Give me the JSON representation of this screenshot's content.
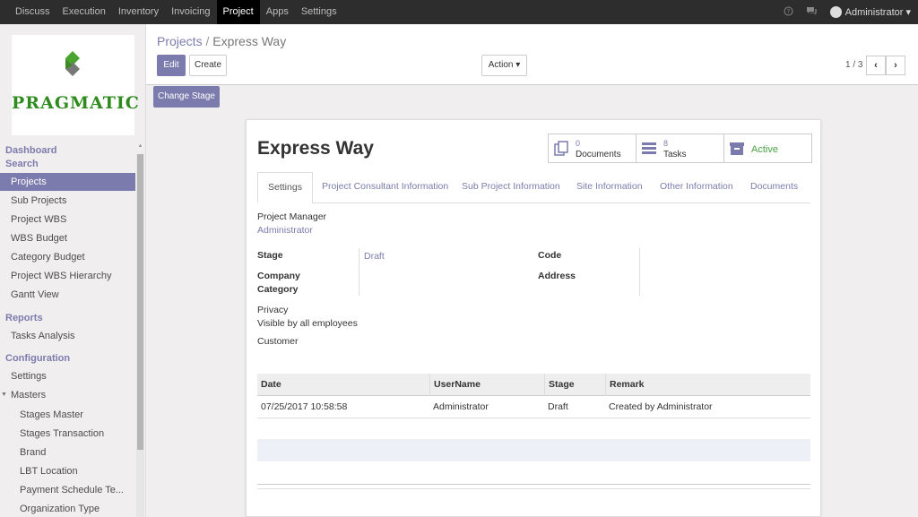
{
  "navbar": {
    "menu": [
      {
        "label": "Discuss",
        "active": false
      },
      {
        "label": "Execution",
        "active": false
      },
      {
        "label": "Inventory",
        "active": false
      },
      {
        "label": "Invoicing",
        "active": false
      },
      {
        "label": "Project",
        "active": true
      },
      {
        "label": "Apps",
        "active": false
      },
      {
        "label": "Settings",
        "active": false
      }
    ],
    "user": "Administrator ▾",
    "icons": [
      "help-icon",
      "chat-icon"
    ]
  },
  "logo": {
    "text": "PRAGMATIC"
  },
  "sidebar": {
    "dashboard": "Dashboard",
    "search": "Search",
    "search_items": [
      "Projects",
      "Sub Projects",
      "Project WBS",
      "WBS Budget",
      "Category Budget",
      "Project WBS Hierarchy",
      "Gantt View"
    ],
    "reports": "Reports",
    "reports_items": [
      "Tasks Analysis"
    ],
    "configuration": "Configuration",
    "config_items": [
      "Settings"
    ],
    "masters": "Masters",
    "masters_items": [
      "Stages Master",
      "Stages Transaction",
      "Brand",
      "LBT Location",
      "Payment Schedule Te...",
      "Organization Type"
    ]
  },
  "control": {
    "breadcrumb_root": "Projects",
    "breadcrumb_sep": " / ",
    "breadcrumb_current": "Express Way",
    "edit": "Edit",
    "create": "Create",
    "action": "Action ▾",
    "pager": "1 / 3",
    "prev": "‹",
    "next": "›"
  },
  "statusbar": {
    "change_stage": "Change Stage"
  },
  "form": {
    "title": "Express Way",
    "smart_buttons": {
      "documents_count": "0",
      "documents_label": "Documents",
      "tasks_count": "8",
      "tasks_label": "Tasks",
      "active_label": "Active"
    },
    "tabs": [
      "Settings",
      "Project Consultant Information",
      "Sub Project Information",
      "Site Information",
      "Other Information",
      "Documents"
    ],
    "project_manager_label": "Project Manager",
    "project_manager": "Administrator",
    "stage_label": "Stage",
    "stage_value": "Draft",
    "company_label": "Company",
    "category_label": "Category",
    "code_label": "Code",
    "address_label": "Address",
    "privacy_label": "Privacy",
    "privacy_value": "Visible by all employees",
    "customer_label": "Customer",
    "table": {
      "headers": [
        "Date",
        "UserName",
        "Stage",
        "Remark"
      ],
      "rows": [
        [
          "07/25/2017 10:58:58",
          "Administrator",
          "Draft",
          "Created by Administrator"
        ]
      ]
    }
  },
  "colors": {
    "accent": "#7c7bad",
    "active_green": "#47a341",
    "navbar": "#2d2d2d"
  }
}
